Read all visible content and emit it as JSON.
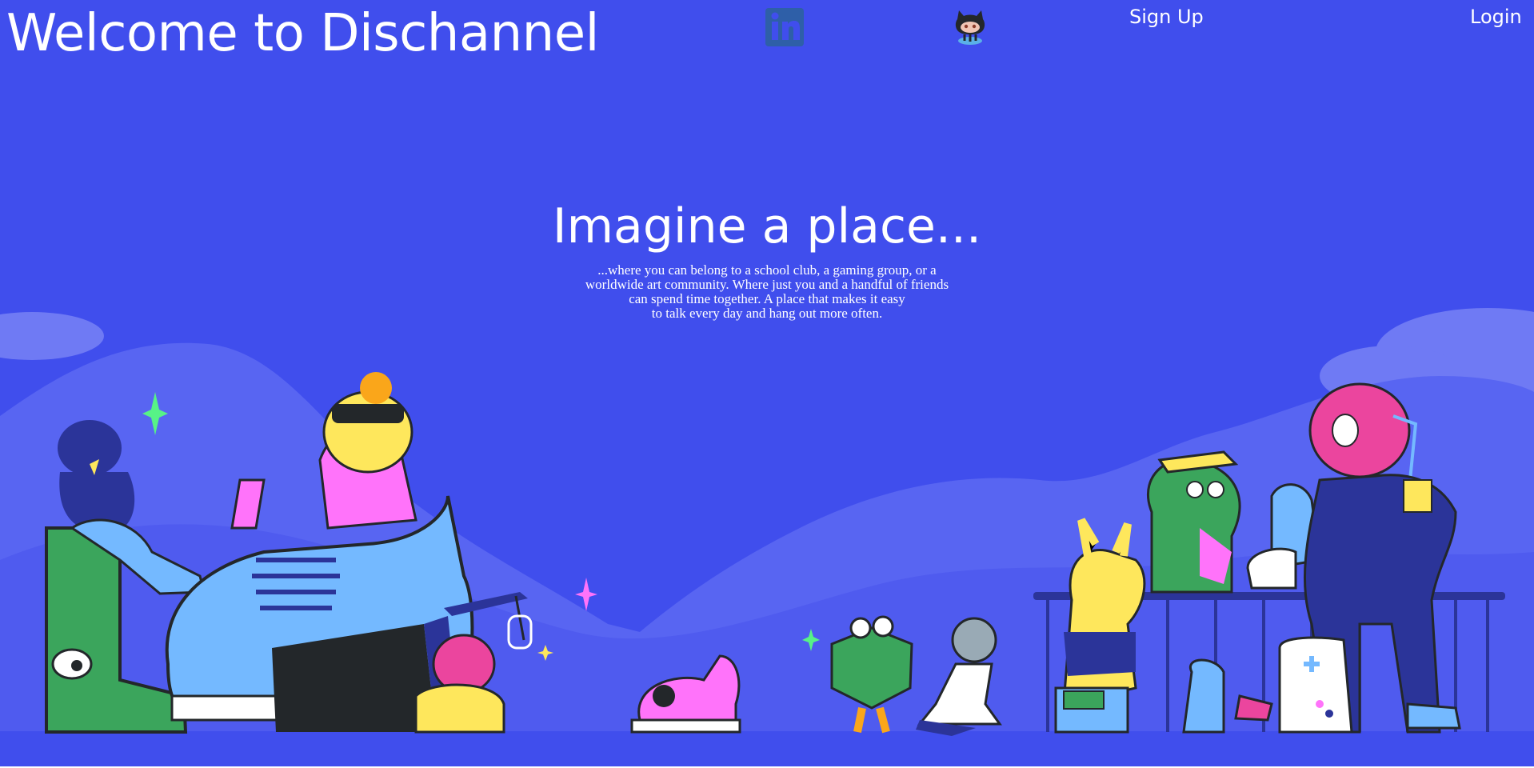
{
  "header": {
    "title": "Welcome to Dischannel",
    "linkedin_icon": "linkedin-icon",
    "github_icon": "github-octocat-icon",
    "signup_label": "Sign Up",
    "login_label": "Login"
  },
  "hero": {
    "headline": "Imagine a place...",
    "tagline_lines": [
      "...where you can belong to a school club, a gaming group, or a",
      "worldwide art community. Where just you and a handful of friends",
      "can spend time together. A place that makes it easy",
      "to talk every day and hang out more often."
    ],
    "illustration": "community-characters-illustration"
  },
  "colors": {
    "background": "#404eed",
    "text": "#ffffff",
    "mountain": "#5865f2",
    "cloud": "#6f7af4",
    "linkedin": "#2e5fa8",
    "green": "#3ba55c",
    "pink": "#ff73fa",
    "yellow": "#fee75c",
    "light_blue": "#74b9ff",
    "dark_navy": "#23272a"
  }
}
